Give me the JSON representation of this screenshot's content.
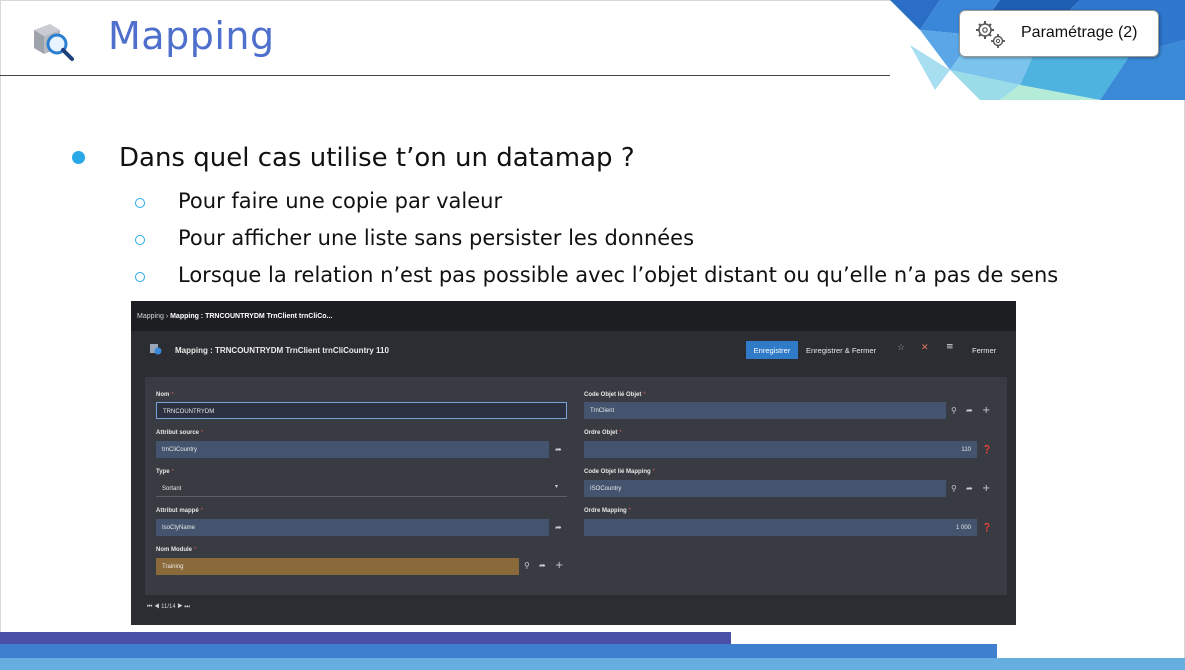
{
  "slide": {
    "title": "Mapping",
    "param_button_label": "Paramétrage (2)",
    "bullet_main": "Dans quel cas utilise t’on un datamap ?",
    "sub_bullets": [
      "Pour faire une copie par valeur",
      "Pour afficher une liste sans persister les données",
      "Lorsque la relation n’est pas possible avec l’objet distant ou qu’elle n’a pas de sens"
    ]
  },
  "app": {
    "breadcrumb_root": "Mapping",
    "breadcrumb_current": "Mapping : TRNCOUNTRYDM TrnClient trnCliCo...",
    "header_title": "Mapping : TRNCOUNTRYDM TrnClient trnCliCountry 110",
    "btn_save": "Enregistrer",
    "btn_save_close": "Enregistrer & Fermer",
    "btn_close": "Fermer",
    "fields": {
      "nom_label": "Nom",
      "nom_value": "TRNCOUNTRYDM",
      "attr_source_label": "Attribut source",
      "attr_source_value": "trnCliCountry",
      "type_label": "Type",
      "type_value": "Sortant",
      "attr_mappe_label": "Attribut mappé",
      "attr_mappe_value": "IsoCtyName",
      "nom_module_label": "Nom Module",
      "nom_module_value": "Training",
      "code_obj_label": "Code Objet lié Objet",
      "code_obj_value": "TrnClient",
      "ordre_obj_label": "Ordre Objet",
      "ordre_obj_value": "110",
      "code_map_label": "Code Objet lié Mapping",
      "code_map_value": "ISOCountry",
      "ordre_map_label": "Ordre Mapping",
      "ordre_map_value": "1 000"
    },
    "pager": "11/14"
  },
  "colors": {
    "title": "#4f6fcc",
    "bullet": "#29a9e8",
    "save_button": "#2f7bc8",
    "module_field": "#8a6a3a"
  },
  "icons": [
    "search-icon",
    "gear-icon",
    "share-icon",
    "plus-icon",
    "help-icon",
    "star-icon",
    "close-icon",
    "menu-icon"
  ]
}
